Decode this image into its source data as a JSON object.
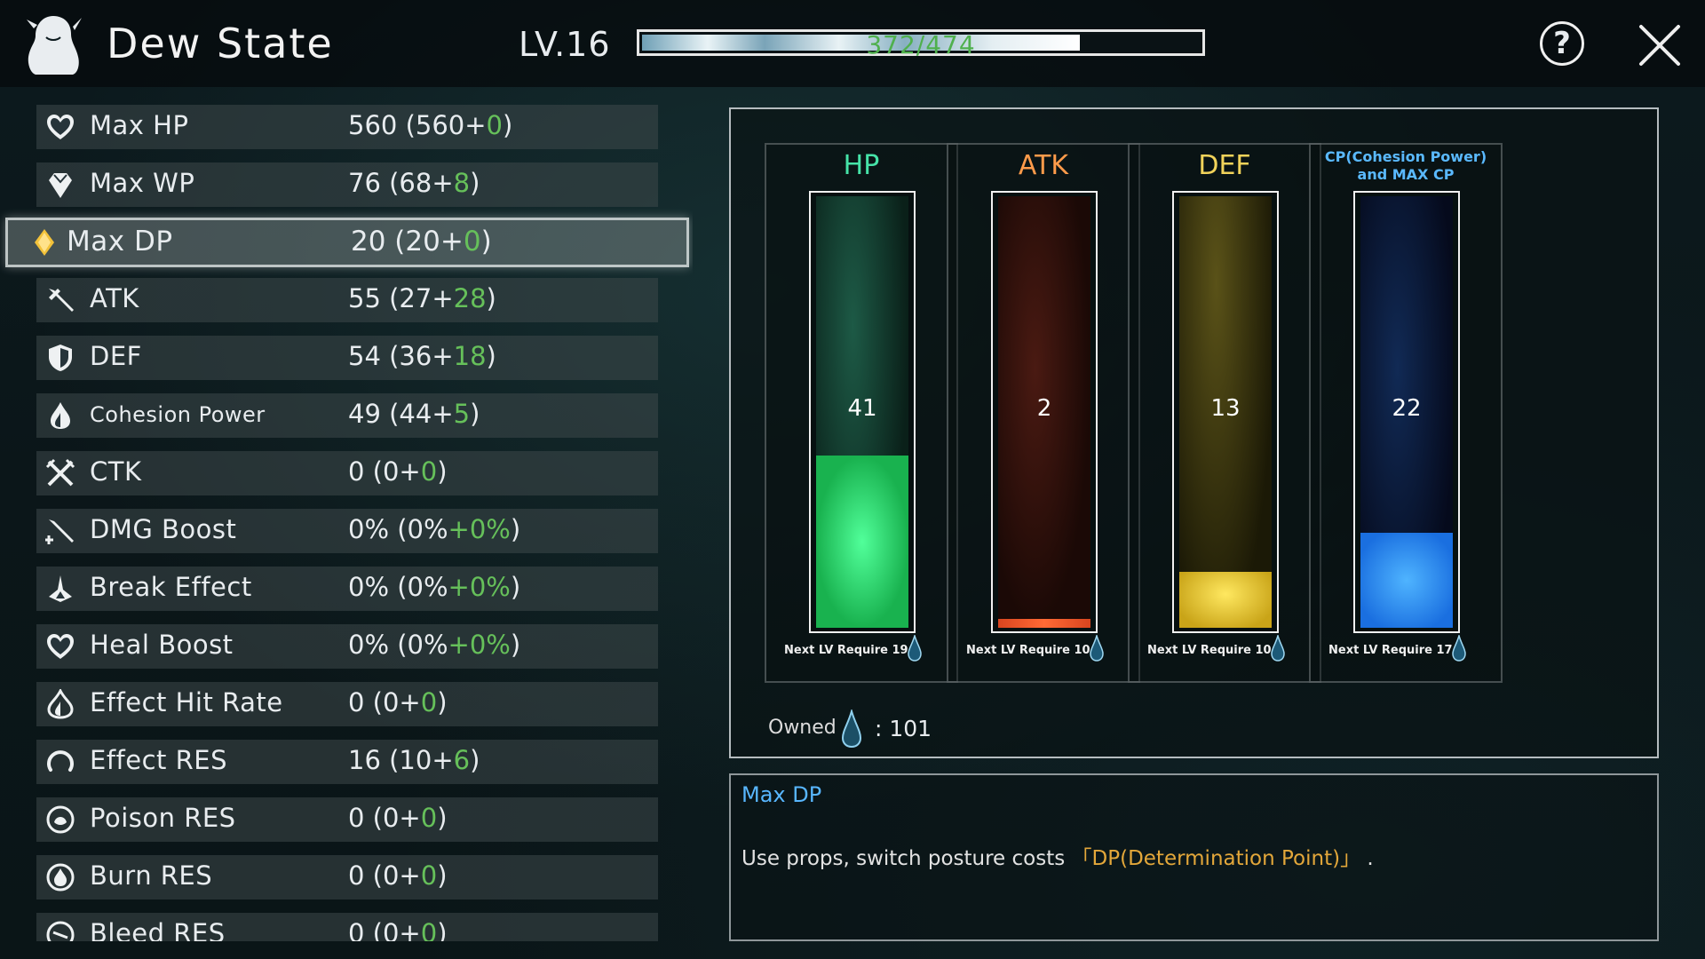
{
  "header": {
    "title": "Dew State",
    "level": "LV.16",
    "exp_text": "372/474",
    "exp_progress": 0.785
  },
  "stats": [
    {
      "name": "Max HP",
      "value": "560 (560+",
      "bonus": "0",
      "suffix": ")",
      "icon": "heart-icon"
    },
    {
      "name": "Max WP",
      "value": "76 (68+",
      "bonus": "8",
      "suffix": ")",
      "icon": "gem-icon"
    },
    {
      "name": "Max DP",
      "value": "20 (20+",
      "bonus": "0",
      "suffix": ")",
      "icon": "diamond-icon",
      "selected": true
    },
    {
      "name": "ATK",
      "value": "55 (27+",
      "bonus": "28",
      "suffix": ")",
      "icon": "sword-icon"
    },
    {
      "name": "DEF",
      "value": "54 (36+",
      "bonus": "18",
      "suffix": ")",
      "icon": "shield-icon"
    },
    {
      "name": "Cohesion Power",
      "value": "49 (44+",
      "bonus": "5",
      "suffix": ")",
      "icon": "flame-icon"
    },
    {
      "name": "CTK",
      "value": "0 (0+",
      "bonus": "0",
      "suffix": ")",
      "icon": "crossed-swords-icon"
    },
    {
      "name": "DMG Boost",
      "value": "0% (0%",
      "bonus": "+0%",
      "suffix": ")",
      "icon": "sword-plus-icon"
    },
    {
      "name": "Break Effect",
      "value": "0% (0%",
      "bonus": "+0%",
      "suffix": ")",
      "icon": "break-icon"
    },
    {
      "name": "Heal Boost",
      "value": "0% (0%",
      "bonus": "+0%",
      "suffix": ")",
      "icon": "heart-icon"
    },
    {
      "name": "Effect Hit Rate",
      "value": "0 (0+",
      "bonus": "0",
      "suffix": ")",
      "icon": "hit-icon"
    },
    {
      "name": "Effect RES",
      "value": "16 (10+",
      "bonus": "6",
      "suffix": ")",
      "icon": "ring-icon"
    },
    {
      "name": "Poison RES",
      "value": "0 (0+",
      "bonus": "0",
      "suffix": ")",
      "icon": "poison-icon"
    },
    {
      "name": "Burn RES",
      "value": "0 (0+",
      "bonus": "0",
      "suffix": ")",
      "icon": "burn-icon"
    },
    {
      "name": "Bleed RES",
      "value": "0 (0+",
      "bonus": "0",
      "suffix": ")",
      "icon": "bleed-icon"
    }
  ],
  "allocation": [
    {
      "label": "HP",
      "color": "#46e3a8",
      "value": "41",
      "next": "Next LV Require 19",
      "fill": 0.4
    },
    {
      "label": "ATK",
      "color": "#ff9b4a",
      "value": "2",
      "next": "Next LV Require 10",
      "fill": 0.02
    },
    {
      "label": "DEF",
      "color": "#f2d35a",
      "value": "13",
      "next": "Next LV Require 10",
      "fill": 0.13
    },
    {
      "label": "CP(Cohesion Power) and MAX CP",
      "color": "#5ab9ff",
      "value": "22",
      "next": "Next LV Require 17",
      "fill": 0.22
    }
  ],
  "owned": {
    "label": "Owned",
    "value": ": 101"
  },
  "description": {
    "title": "Max DP",
    "text": "Use props, switch posture costs ",
    "highlight": "「DP(Determination Point)」",
    "tail": " ."
  }
}
